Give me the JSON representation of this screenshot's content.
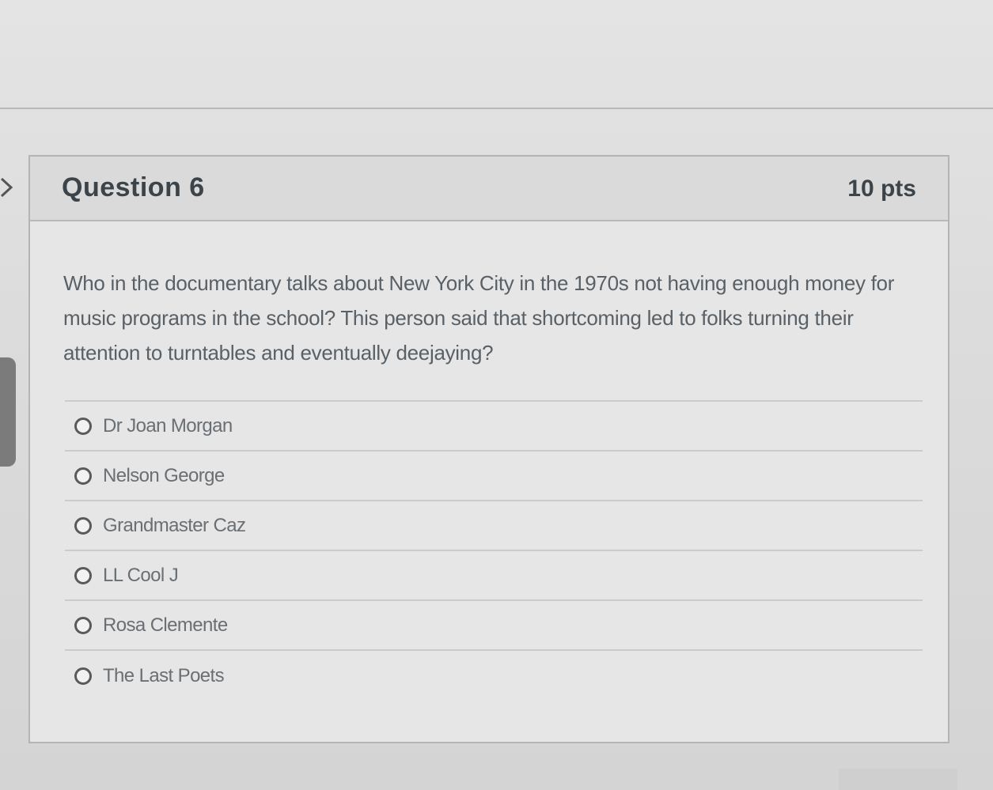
{
  "question": {
    "title": "Question 6",
    "points": "10 pts",
    "text": "Who in the documentary talks about New York City in the 1970s not having enough money for music programs in the school? This person said that shortcoming led to folks turning their attention to turntables and eventually deejaying?",
    "answers": [
      {
        "label": "Dr Joan Morgan",
        "selected": false
      },
      {
        "label": "Nelson George",
        "selected": false
      },
      {
        "label": "Grandmaster Caz",
        "selected": false
      },
      {
        "label": "LL Cool J",
        "selected": false
      },
      {
        "label": "Rosa Clemente",
        "selected": false
      },
      {
        "label": "The Last Poets",
        "selected": false
      }
    ]
  },
  "icons": {
    "edge_chevron": "chevron-right-icon",
    "radio": "radio-unchecked-icon"
  },
  "colors": {
    "header_bg": "#dadada",
    "card_bg": "#e6e6e6",
    "text": "#596066"
  }
}
